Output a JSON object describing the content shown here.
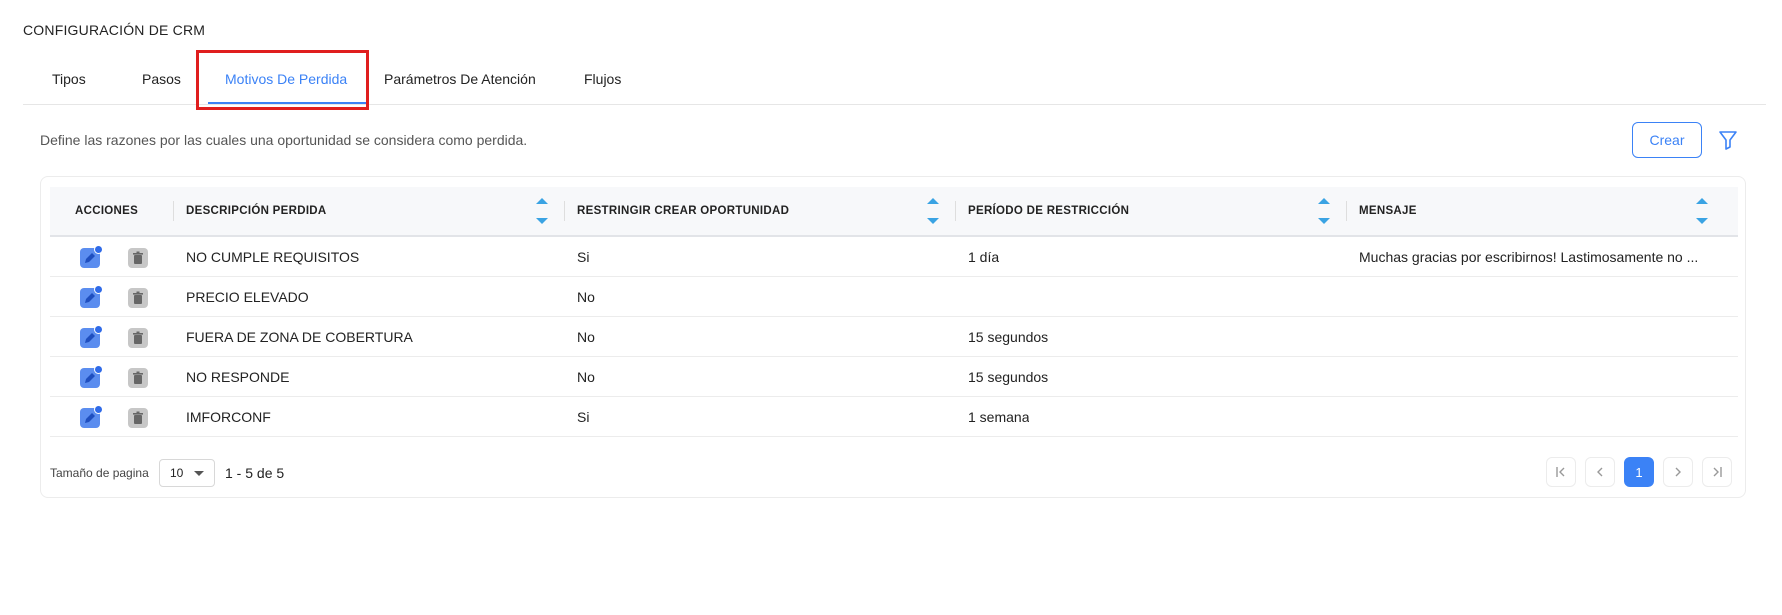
{
  "page": {
    "title": "CONFIGURACIÓN DE CRM",
    "description": "Define las razones por las cuales una oportunidad se considera como perdida."
  },
  "tabs": [
    {
      "label": "Tipos"
    },
    {
      "label": "Pasos"
    },
    {
      "label": "Motivos De Perdida",
      "active": true
    },
    {
      "label": "Parámetros De Atención"
    },
    {
      "label": "Flujos"
    }
  ],
  "toolbar": {
    "create_label": "Crear",
    "filter_icon": "filter-icon"
  },
  "table": {
    "headers": {
      "acciones": "ACCIONES",
      "descripcion": "DESCRIPCIÓN PERDIDA",
      "restringir": "RESTRINGIR CREAR OPORTUNIDAD",
      "periodo": "PERÍODO DE RESTRICCIÓN",
      "mensaje": "MENSAJE"
    },
    "rows": [
      {
        "descripcion": "NO CUMPLE REQUISITOS",
        "restringir": "Si",
        "periodo": "1 día",
        "mensaje": "Muchas gracias por escribirnos! Lastimosamente no ..."
      },
      {
        "descripcion": "PRECIO ELEVADO",
        "restringir": "No",
        "periodo": "",
        "mensaje": ""
      },
      {
        "descripcion": "FUERA DE ZONA DE COBERTURA",
        "restringir": "No",
        "periodo": "15 segundos",
        "mensaje": ""
      },
      {
        "descripcion": "NO RESPONDE",
        "restringir": "No",
        "periodo": "15 segundos",
        "mensaje": ""
      },
      {
        "descripcion": "IMFORCONF",
        "restringir": "Si",
        "periodo": "1 semana",
        "mensaje": ""
      }
    ]
  },
  "pagination": {
    "page_size_label": "Tamaño de pagina",
    "page_size": "10",
    "range": "1 - 5 de 5",
    "current_page": "1"
  },
  "colors": {
    "accent": "#3b82f6",
    "highlight": "#e01e1e",
    "sort_arrows": "#3aa3e3"
  }
}
